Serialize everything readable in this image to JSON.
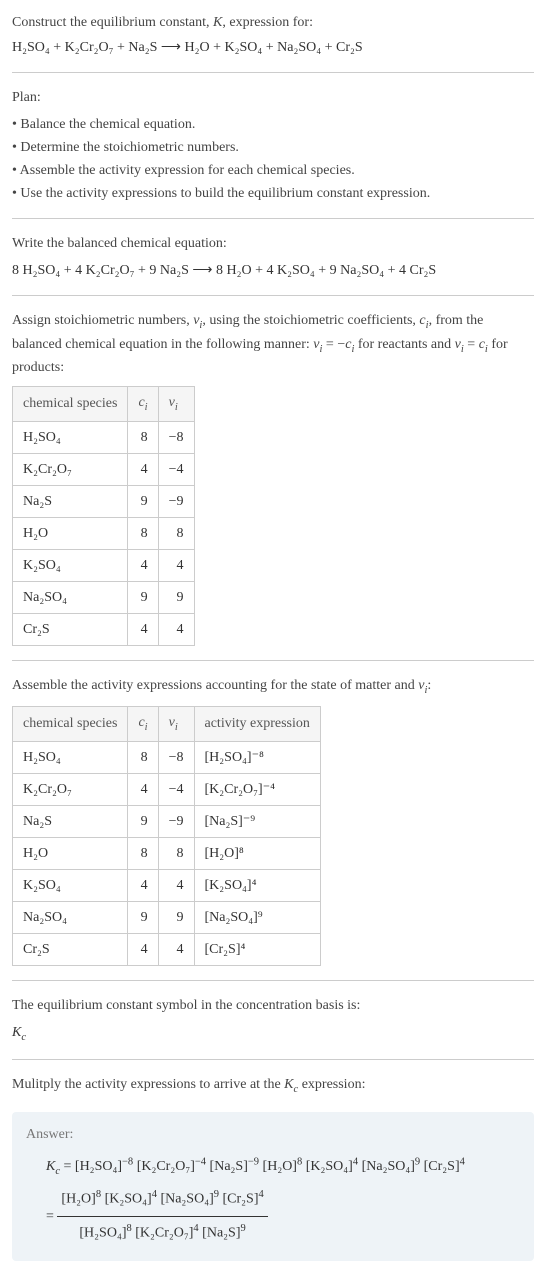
{
  "prompt": {
    "line1": "Construct the equilibrium constant, K, expression for:",
    "equation": "H₂SO₄ + K₂Cr₂O₇ + Na₂S ⟶ H₂O + K₂SO₄ + Na₂SO₄ + Cr₂S"
  },
  "plan": {
    "title": "Plan:",
    "items": [
      "Balance the chemical equation.",
      "Determine the stoichiometric numbers.",
      "Assemble the activity expression for each chemical species.",
      "Use the activity expressions to build the equilibrium constant expression."
    ]
  },
  "balanced": {
    "title": "Write the balanced chemical equation:",
    "equation": "8 H₂SO₄ + 4 K₂Cr₂O₇ + 9 Na₂S ⟶ 8 H₂O + 4 K₂SO₄ + 9 Na₂SO₄ + 4 Cr₂S"
  },
  "stoich": {
    "title": "Assign stoichiometric numbers, νᵢ, using the stoichiometric coefficients, cᵢ, from the balanced chemical equation in the following manner: νᵢ = −cᵢ for reactants and νᵢ = cᵢ for products:",
    "headers": {
      "species": "chemical species",
      "c": "cᵢ",
      "v": "νᵢ"
    },
    "rows": [
      {
        "species": "H₂SO₄",
        "c": "8",
        "v": "−8"
      },
      {
        "species": "K₂Cr₂O₇",
        "c": "4",
        "v": "−4"
      },
      {
        "species": "Na₂S",
        "c": "9",
        "v": "−9"
      },
      {
        "species": "H₂O",
        "c": "8",
        "v": "8"
      },
      {
        "species": "K₂SO₄",
        "c": "4",
        "v": "4"
      },
      {
        "species": "Na₂SO₄",
        "c": "9",
        "v": "9"
      },
      {
        "species": "Cr₂S",
        "c": "4",
        "v": "4"
      }
    ]
  },
  "activity": {
    "title": "Assemble the activity expressions accounting for the state of matter and νᵢ:",
    "headers": {
      "species": "chemical species",
      "c": "cᵢ",
      "v": "νᵢ",
      "expr": "activity expression"
    },
    "rows": [
      {
        "species": "H₂SO₄",
        "c": "8",
        "v": "−8",
        "expr": "[H₂SO₄]⁻⁸"
      },
      {
        "species": "K₂Cr₂O₇",
        "c": "4",
        "v": "−4",
        "expr": "[K₂Cr₂O₇]⁻⁴"
      },
      {
        "species": "Na₂S",
        "c": "9",
        "v": "−9",
        "expr": "[Na₂S]⁻⁹"
      },
      {
        "species": "H₂O",
        "c": "8",
        "v": "8",
        "expr": "[H₂O]⁸"
      },
      {
        "species": "K₂SO₄",
        "c": "4",
        "v": "4",
        "expr": "[K₂SO₄]⁴"
      },
      {
        "species": "Na₂SO₄",
        "c": "9",
        "v": "9",
        "expr": "[Na₂SO₄]⁹"
      },
      {
        "species": "Cr₂S",
        "c": "4",
        "v": "4",
        "expr": "[Cr₂S]⁴"
      }
    ]
  },
  "symbol": {
    "title": "The equilibrium constant symbol in the concentration basis is:",
    "value": "K_c"
  },
  "multiply": {
    "title": "Mulitply the activity expressions to arrive at the K_c expression:"
  },
  "answer": {
    "label": "Answer:",
    "line1": "K_c = [H₂SO₄]⁻⁸ [K₂Cr₂O₇]⁻⁴ [Na₂S]⁻⁹ [H₂O]⁸ [K₂SO₄]⁴ [Na₂SO₄]⁹ [Cr₂S]⁴",
    "eq_prefix": "= ",
    "numerator": "[H₂O]⁸ [K₂SO₄]⁴ [Na₂SO₄]⁹ [Cr₂S]⁴",
    "denominator": "[H₂SO₄]⁸ [K₂Cr₂O₇]⁴ [Na₂S]⁹"
  }
}
